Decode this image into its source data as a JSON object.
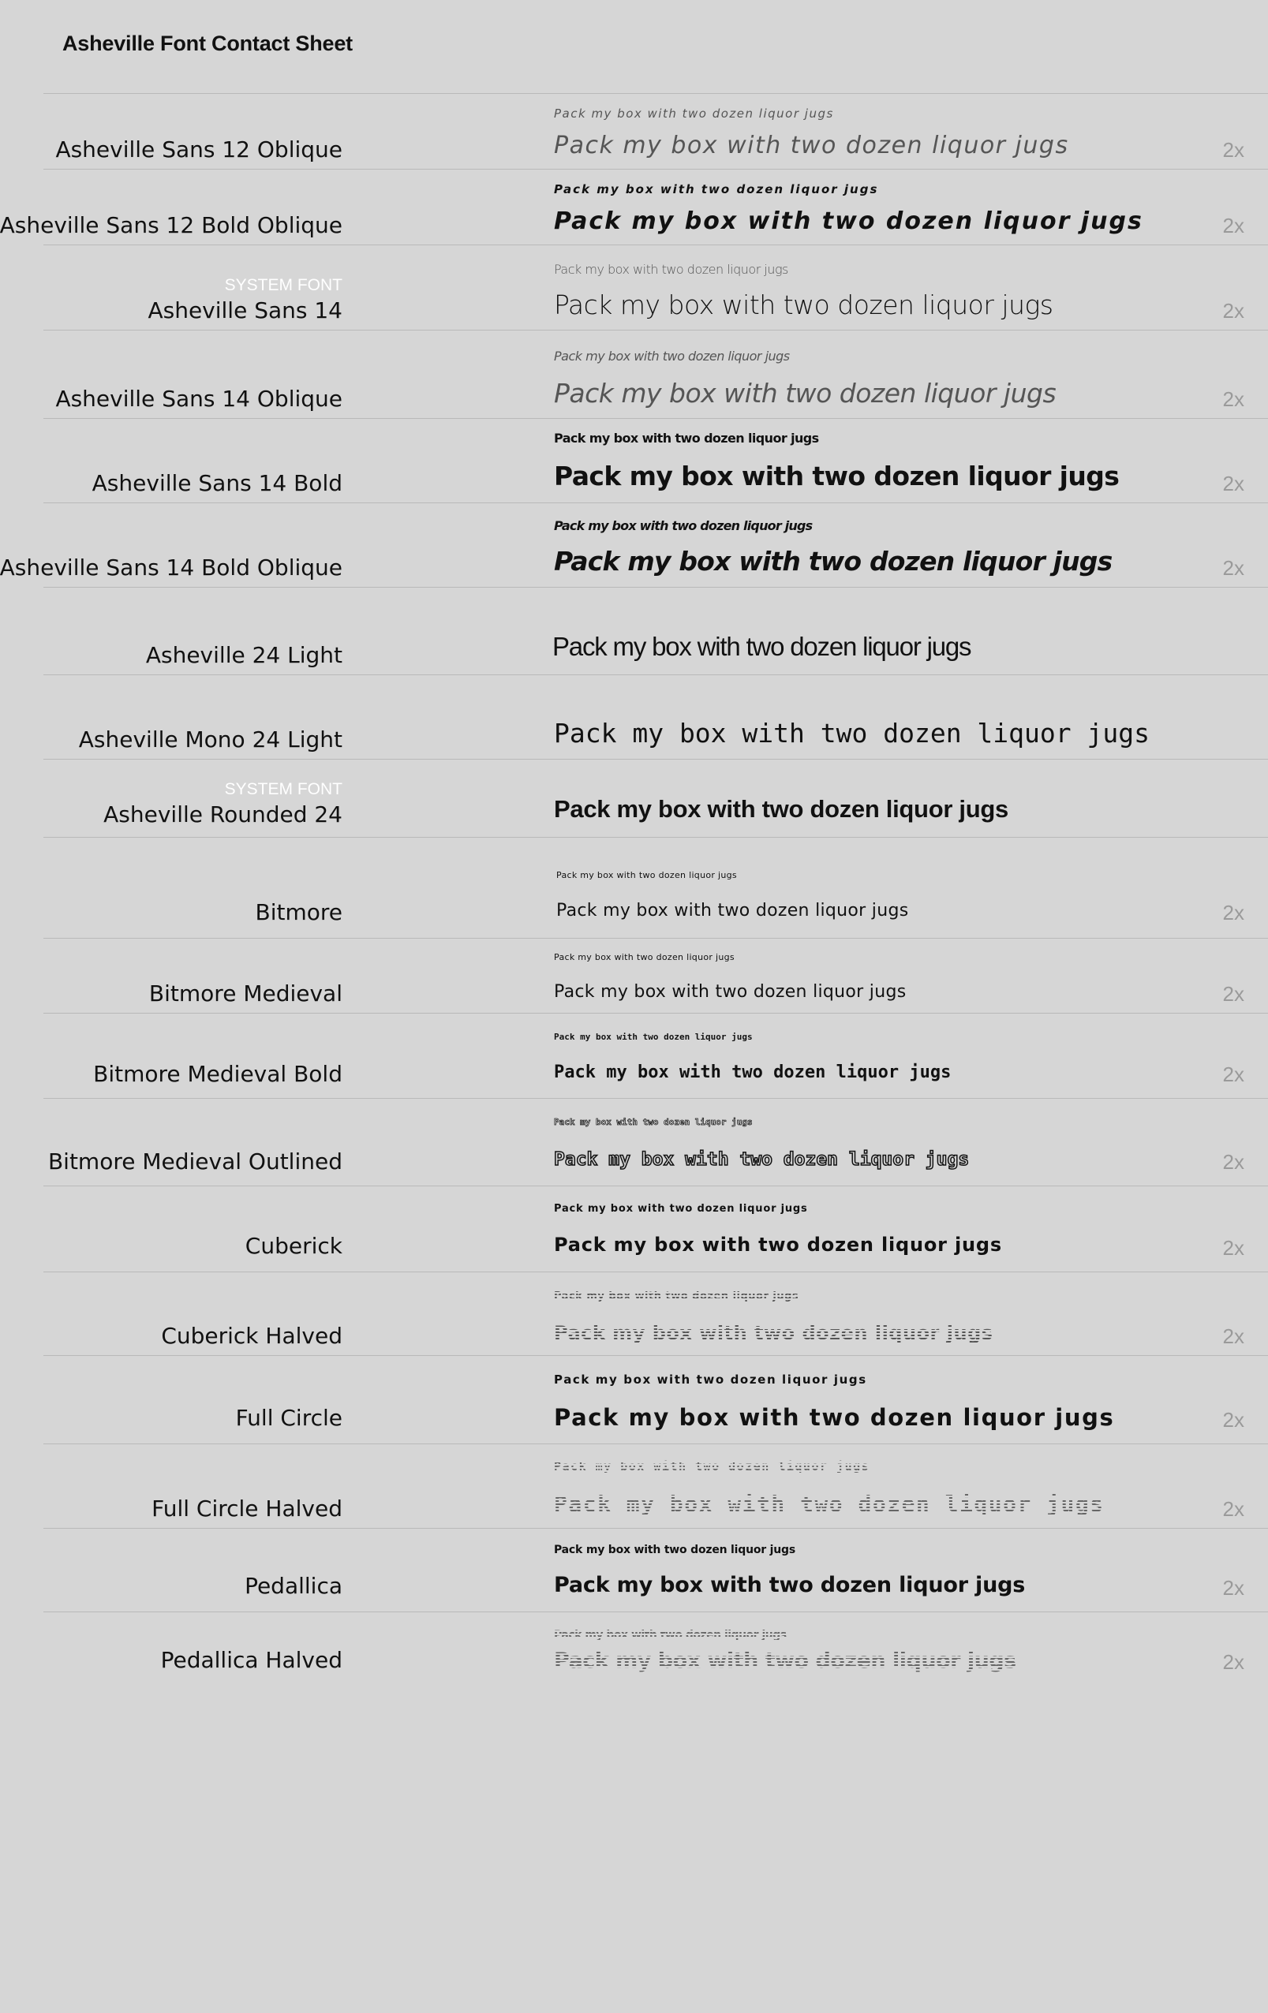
{
  "title": "Asheville Font Contact Sheet",
  "sample_text": "Pack my box with two dozen liquor jugs",
  "system_font_badge": "SYSTEM FONT",
  "rows": [
    {
      "label": "Asheville Sans 12 Oblique",
      "system_font": "",
      "small": "Pack my box with two dozen liquor jugs",
      "big": "Pack my box with two dozen liquor jugs",
      "scale": "2x"
    },
    {
      "label": "Asheville Sans 12 Bold Oblique",
      "system_font": "",
      "small": "Pack my box with two dozen liquor jugs",
      "big": "Pack my box with two dozen liquor jugs",
      "scale": "2x"
    },
    {
      "label": "Asheville Sans 14",
      "system_font": "SYSTEM FONT",
      "small": "Pack my box with two dozen liquor jugs",
      "big": "Pack my box with two dozen liquor jugs",
      "scale": "2x"
    },
    {
      "label": "Asheville Sans 14 Oblique",
      "system_font": "",
      "small": "Pack my box with two dozen liquor jugs",
      "big": "Pack my box with two dozen liquor jugs",
      "scale": "2x"
    },
    {
      "label": "Asheville Sans 14 Bold",
      "system_font": "",
      "small": "Pack my box with two dozen liquor jugs",
      "big": "Pack my box with two dozen liquor jugs",
      "scale": "2x"
    },
    {
      "label": "Asheville Sans 14 Bold Oblique",
      "system_font": "",
      "small": "Pack my box with two dozen liquor jugs",
      "big": "Pack my box with two dozen liquor jugs",
      "scale": "2x"
    },
    {
      "label": "Asheville 24 Light",
      "system_font": "",
      "small": "",
      "big": "Pack my box with two dozen liquor jugs",
      "scale": ""
    },
    {
      "label": "Asheville Mono 24 Light",
      "system_font": "",
      "small": "",
      "big": "Pack my box with two dozen liquor jugs",
      "scale": ""
    },
    {
      "label": "Asheville Rounded 24",
      "system_font": "SYSTEM FONT",
      "small": "",
      "big": "Pack my box with two dozen liquor jugs",
      "scale": ""
    },
    {
      "label": "Bitmore",
      "system_font": "",
      "small": "Pack my box with two dozen liquor jugs",
      "big": "Pack my box with two dozen liquor jugs",
      "scale": "2x"
    },
    {
      "label": "Bitmore Medieval",
      "system_font": "",
      "small": "Pack my box with two dozen liquor jugs",
      "big": "Pack my box with two dozen liquor jugs",
      "scale": "2x"
    },
    {
      "label": "Bitmore Medieval Bold",
      "system_font": "",
      "small": "Pack my box with two dozen liquor jugs",
      "big": "Pack my box with two dozen liquor jugs",
      "scale": "2x"
    },
    {
      "label": "Bitmore Medieval Outlined",
      "system_font": "",
      "small": "Pack my box with two dozen liquor jugs",
      "big": "Pack my box with two dozen liquor jugs",
      "scale": "2x"
    },
    {
      "label": "Cuberick",
      "system_font": "",
      "small": "Pack my box with two dozen liquor jugs",
      "big": "Pack my box with two dozen liquor jugs",
      "scale": "2x"
    },
    {
      "label": "Cuberick Halved",
      "system_font": "",
      "small": "Pack my box with two dozen liquor jugs",
      "big": "Pack my box with two dozen liquor jugs",
      "scale": "2x"
    },
    {
      "label": "Full Circle",
      "system_font": "",
      "small": "Pack my box with two dozen liquor jugs",
      "big": "Pack my box with two dozen liquor jugs",
      "scale": "2x"
    },
    {
      "label": "Full Circle Halved",
      "system_font": "",
      "small": "Pack my box with two dozen liquor jugs",
      "big": "Pack my box with two dozen liquor jugs",
      "scale": "2x"
    },
    {
      "label": "Pedallica",
      "system_font": "",
      "small": "Pack my box with two dozen liquor jugs",
      "big": "Pack my box with two dozen liquor jugs",
      "scale": "2x"
    },
    {
      "label": "Pedallica Halved",
      "system_font": "",
      "small": "Pack my box with two dozen liquor jugs",
      "big": "Pack my box with two dozen liquor jugs",
      "scale": "2x"
    }
  ]
}
